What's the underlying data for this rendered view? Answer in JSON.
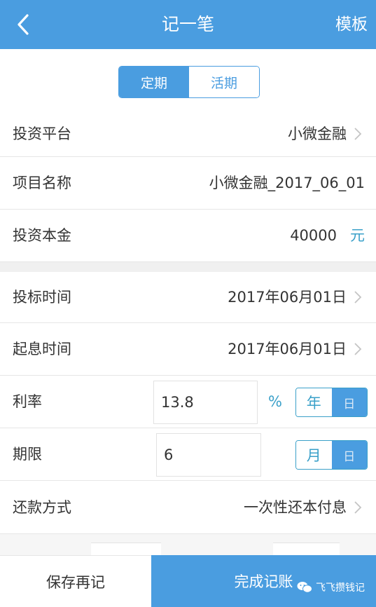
{
  "header": {
    "title": "记一笔",
    "template_label": "模板",
    "back_icon": "chevron-left-icon"
  },
  "mode_tabs": {
    "fixed_label": "定期",
    "current_label": "活期",
    "selected": "定期"
  },
  "fields": {
    "platform": {
      "label": "投资平台",
      "value": "小微金融"
    },
    "project": {
      "label": "项目名称",
      "value": "小微金融_2017_06_01"
    },
    "principal": {
      "label": "投资本金",
      "value": "40000",
      "unit": "元"
    },
    "bid_time": {
      "label": "投标时间",
      "value": "2017年06月01日"
    },
    "interest_start": {
      "label": "起息时间",
      "value": "2017年06月01日"
    },
    "rate": {
      "label": "利率",
      "value": "13.8",
      "unit": "%",
      "period_year": "年",
      "period_day": "日",
      "selected": "年"
    },
    "term": {
      "label": "期限",
      "value": "6",
      "unit_month": "月",
      "unit_day": "日",
      "selected": "月"
    },
    "repayment": {
      "label": "还款方式",
      "value": "一次性还本付息"
    }
  },
  "footer": {
    "save_again_label": "保存再记",
    "done_label": "完成记账"
  },
  "watermark": {
    "text": "飞飞攒钱记"
  },
  "colors": {
    "primary": "#4a9de0",
    "accent": "#3aa0c9"
  }
}
